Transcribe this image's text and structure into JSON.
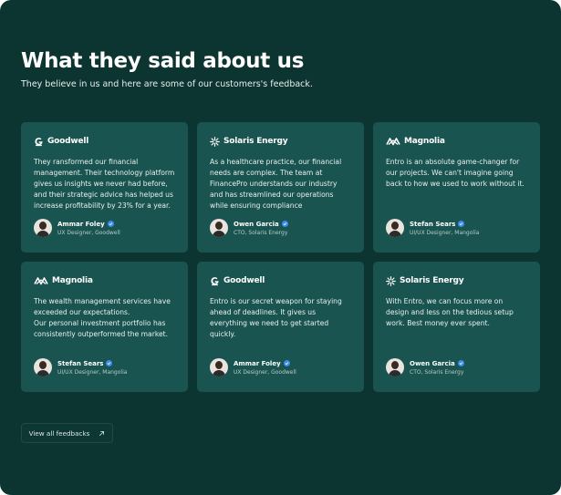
{
  "header": {
    "title": "What they said about us",
    "subtitle": "They believe in us and here are some of our customers's feedback."
  },
  "cards": [
    {
      "brand": "Goodwell",
      "brand_icon": "goodwell-logo-icon",
      "quote": "They ransformed our financial management. Their technology platform gives us insights we never had before, and their strategic advice has helped us increase profitability by 23% for a year.",
      "name": "Ammar Foley",
      "role": "UX Designer, Goodwell"
    },
    {
      "brand": "Solaris Energy",
      "brand_icon": "solaris-logo-icon",
      "quote": "As a healthcare practice, our financial needs are complex. The team at FinancePro understands our industry and has streamlined our operations while ensuring compliance",
      "name": "Owen Garcia",
      "role": "CTO, Solaris Energy"
    },
    {
      "brand": "Magnolia",
      "brand_icon": "magnolia-logo-icon",
      "quote": "Entro is an absolute game-changer for our projects. We can't imagine going back to how we used to work without it.",
      "name": "Stefan Sears",
      "role": "UI/UX Designer, Mangolia"
    },
    {
      "brand": "Magnolia",
      "brand_icon": "magnolia-logo-icon",
      "quote": "The wealth management services have exceeded our expectations.\nOur personal investment portfolio has consistently outperformed the market.",
      "name": "Stefan Sears",
      "role": "UI/UX Designer, Mangolia"
    },
    {
      "brand": "Goodwell",
      "brand_icon": "goodwell-logo-icon",
      "quote": "Entro is our secret weapon for staying ahead of deadlines. It gives us everything we need to get started quickly.",
      "name": "Ammar Foley",
      "role": "UX Designer, Goodwell"
    },
    {
      "brand": "Solaris Energy",
      "brand_icon": "solaris-logo-icon",
      "quote": "With Entro, we can focus more on design and less on the tedious setup work. Best money ever spent.",
      "name": "Owen Garcia",
      "role": "CTO, Solaris Energy"
    }
  ],
  "footer": {
    "view_all_label": "View all feedbacks",
    "view_all_icon": "arrow-up-right-icon"
  },
  "colors": {
    "background": "#0c3431",
    "card": "#1a5450",
    "verified": "#3b8cf0"
  }
}
